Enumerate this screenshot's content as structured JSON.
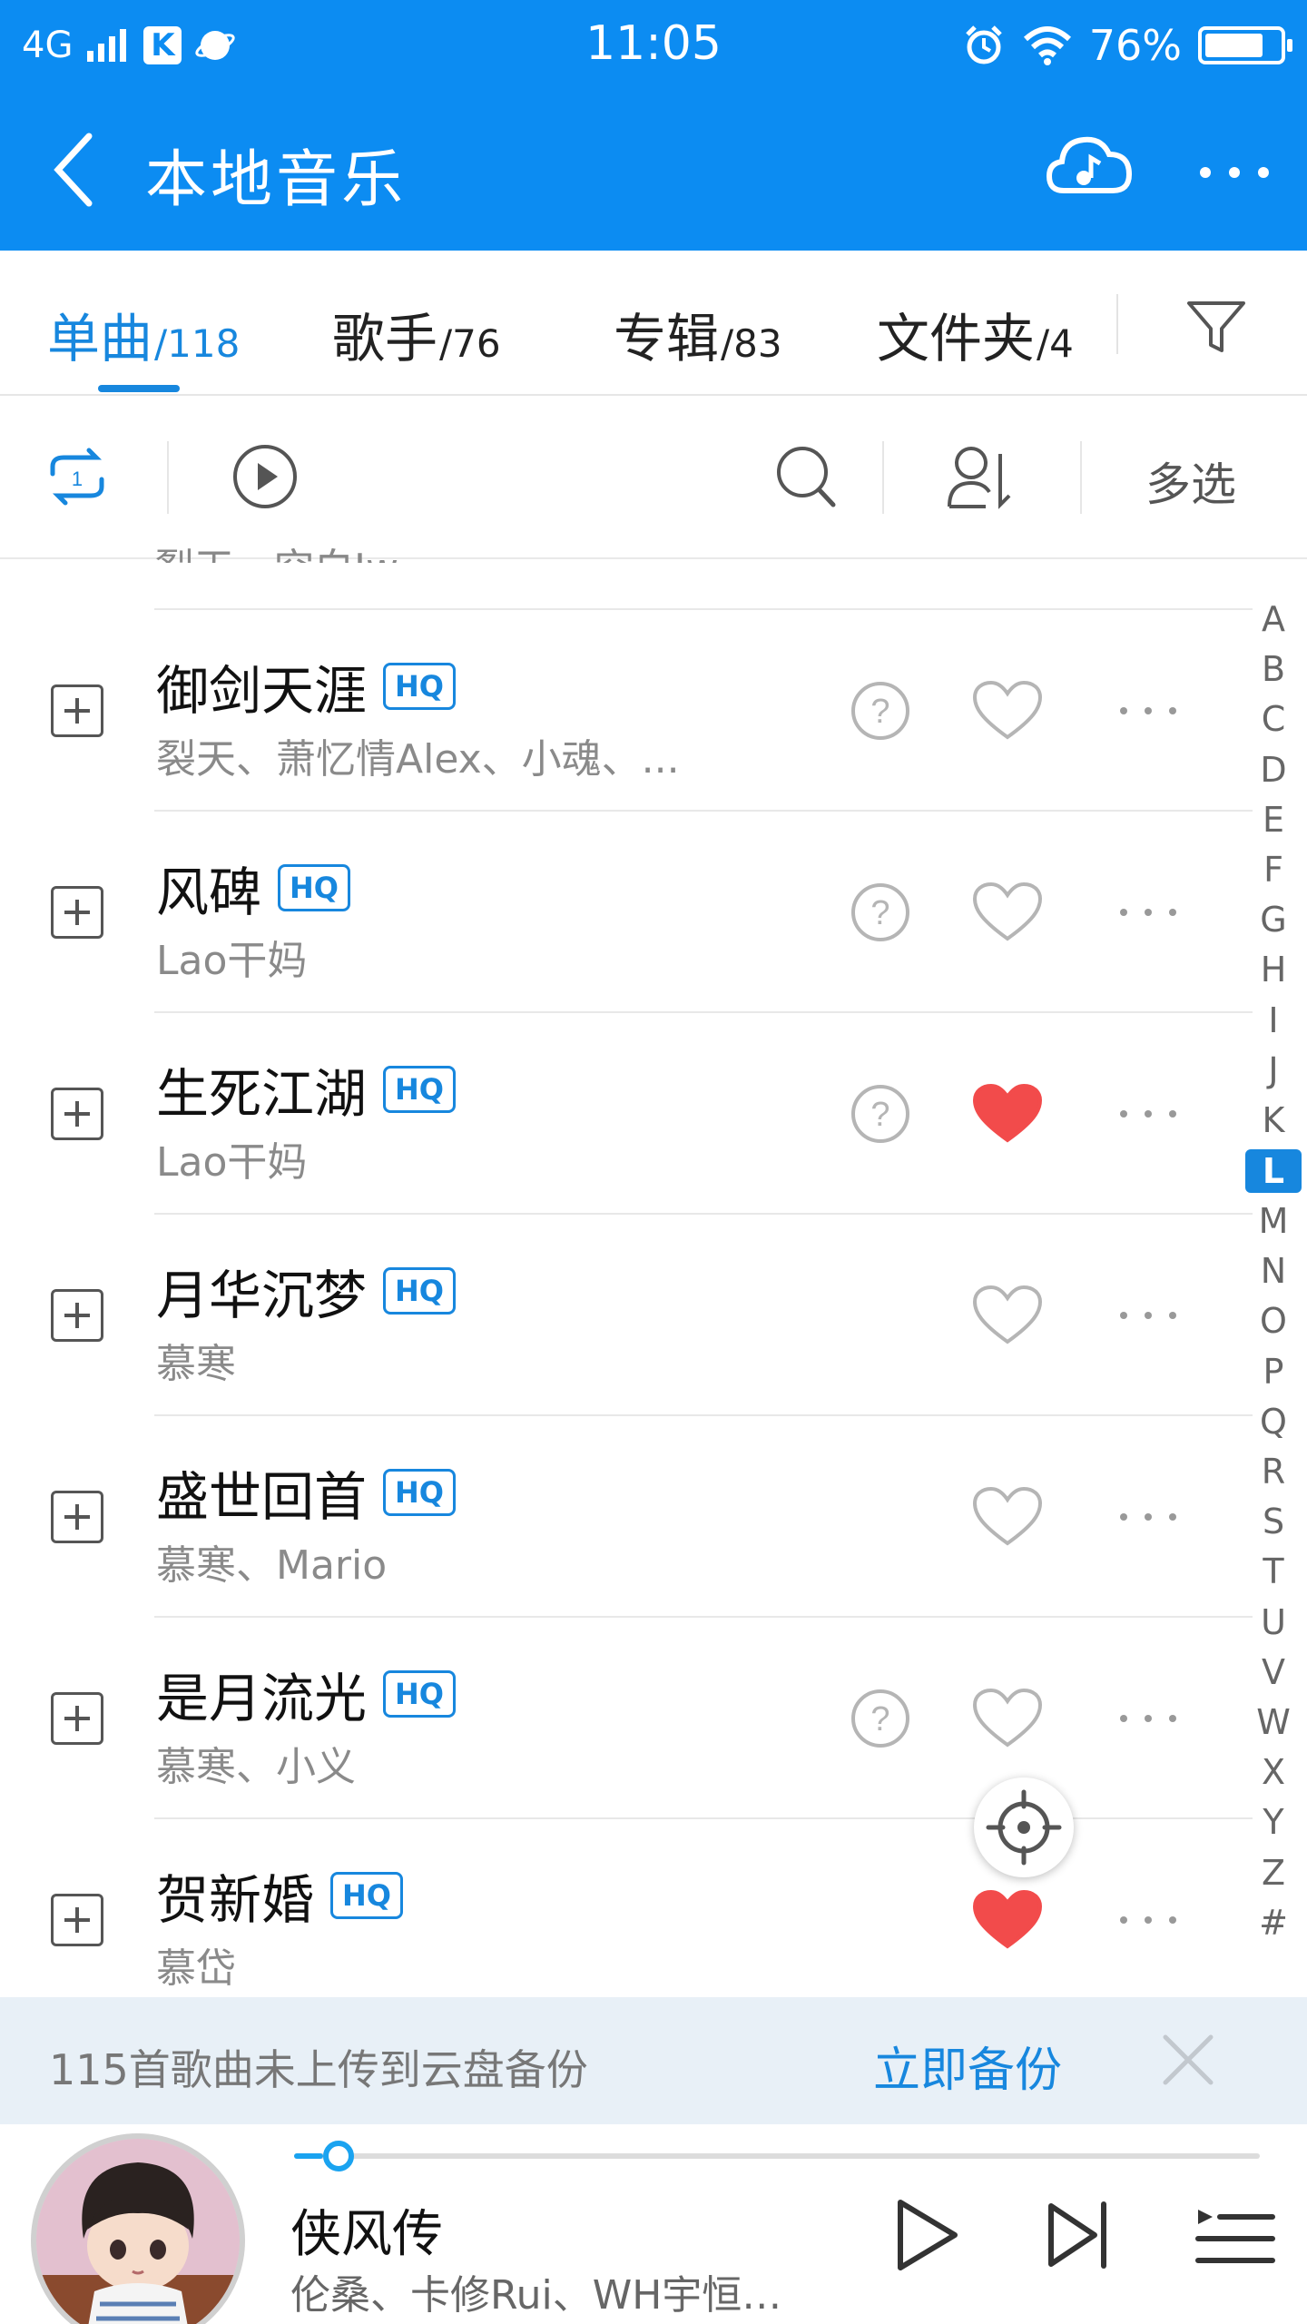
{
  "status_bar": {
    "network": "4G",
    "time": "11:05",
    "battery": "76%"
  },
  "header": {
    "title": "本地音乐"
  },
  "tabs": [
    {
      "label": "单曲",
      "count": "/118",
      "active": true
    },
    {
      "label": "歌手",
      "count": "/76",
      "active": false
    },
    {
      "label": "专辑",
      "count": "/83",
      "active": false
    },
    {
      "label": "文件夹",
      "count": "/4",
      "active": false
    }
  ],
  "toolbar": {
    "multi_select": "多选"
  },
  "list": {
    "partial_artist": "裂天、空白Jw",
    "songs": [
      {
        "title": "御剑天涯",
        "hq": "HQ",
        "artist": "裂天、萧忆情Alex、小魂、...",
        "question": true,
        "liked": false
      },
      {
        "title": "风碑",
        "hq": "HQ",
        "artist": "Lao干妈",
        "question": true,
        "liked": false
      },
      {
        "title": "生死江湖",
        "hq": "HQ",
        "artist": "Lao干妈",
        "question": true,
        "liked": true
      },
      {
        "title": "月华沉梦",
        "hq": "HQ",
        "artist": "慕寒",
        "question": false,
        "liked": false
      },
      {
        "title": "盛世回首",
        "hq": "HQ",
        "artist": "慕寒、Mario",
        "question": false,
        "liked": false
      },
      {
        "title": "是月流光",
        "hq": "HQ",
        "artist": "慕寒、小义",
        "question": true,
        "liked": false
      },
      {
        "title": "贺新婚",
        "hq": "HQ",
        "artist": "慕岱",
        "question": false,
        "liked": true
      }
    ]
  },
  "alphabet": [
    "A",
    "B",
    "C",
    "D",
    "E",
    "F",
    "G",
    "H",
    "I",
    "J",
    "K",
    "L",
    "M",
    "N",
    "O",
    "P",
    "Q",
    "R",
    "S",
    "T",
    "U",
    "V",
    "W",
    "X",
    "Y",
    "Z",
    "#"
  ],
  "alphabet_selected": "L",
  "banner": {
    "message": "115首歌曲未上传到云盘备份",
    "action": "立即备份"
  },
  "player": {
    "title": "侠风传",
    "artist": "伦桑、卡修Rui、WH宇恒…",
    "progress": 0.03
  },
  "colors": {
    "brand": "#0c8cf2",
    "accent": "#1787de",
    "heart_on": "#f24b4b"
  }
}
